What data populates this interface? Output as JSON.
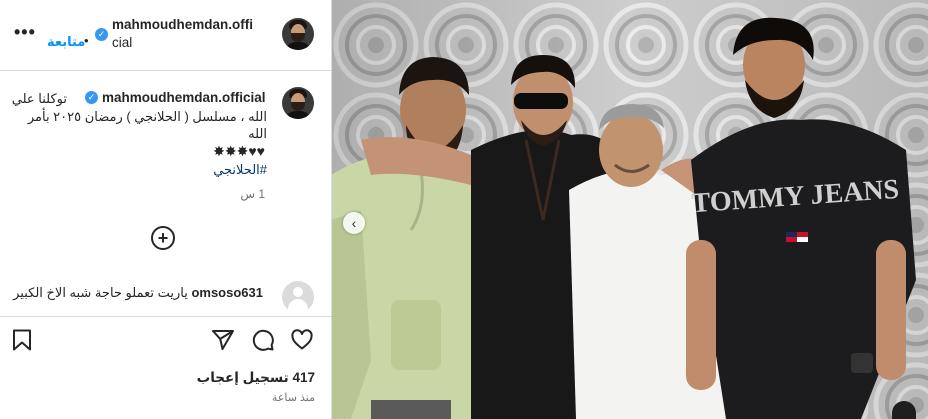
{
  "header": {
    "username": "mahmoudhemdan.official",
    "username_line1": "mahmoudhemdan.offi",
    "username_line2": "cial",
    "follow_label": "متابعة",
    "separator": "•",
    "more_label": "•••"
  },
  "post": {
    "author": "mahmoudhemdan.official",
    "caption_line1": "توكلنا علي",
    "caption_line2": "الله ، مسلسل ( الحلانجي ) رمضان ٢٠٢٥ بأمر",
    "caption_line3": "الله",
    "caption_emojis": "♥♥✸✸✸",
    "hashtag": "#الحلانجي",
    "time": "1 س",
    "load_more": "+"
  },
  "comment": {
    "user": "omsoso631",
    "text": "ياريت تعملو حاجة شبه الاخ الكبير"
  },
  "actions": {
    "likes_label": "417 تسجيل إعجاب",
    "time_ago": "منذ ساعة"
  },
  "photo": {
    "prev_label": "‹"
  },
  "icons": [
    "like-icon",
    "comment-icon",
    "share-icon",
    "save-icon",
    "verified-icon",
    "add-circle-icon"
  ],
  "colors": {
    "accent": "#0095f6",
    "verified": "#3897f0",
    "text": "#262626",
    "muted": "#737373",
    "hashtag": "#00376b"
  }
}
